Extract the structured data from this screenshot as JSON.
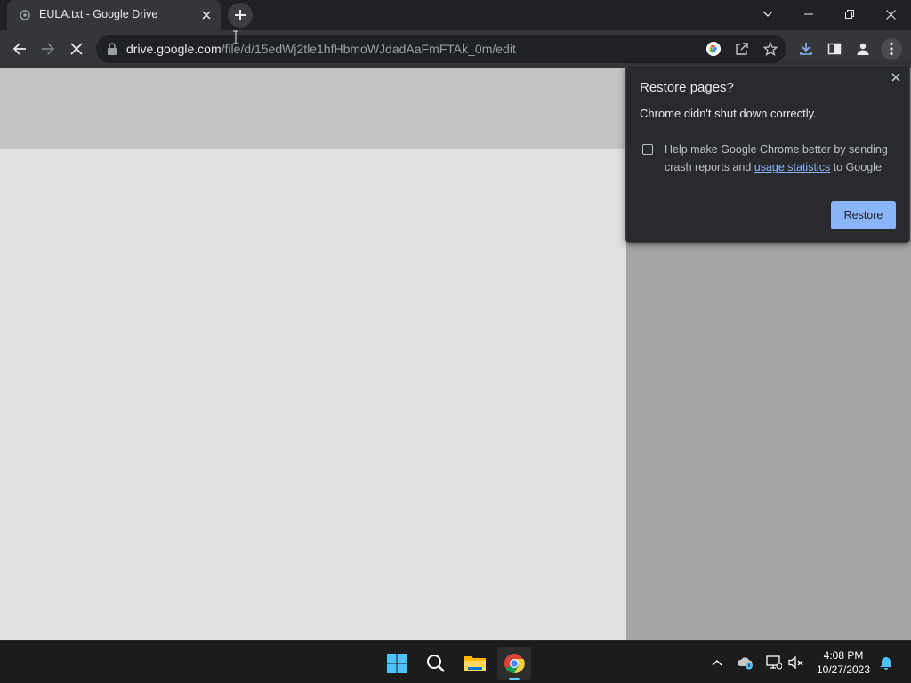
{
  "tab": {
    "title": "EULA.txt - Google Drive"
  },
  "address_bar": {
    "host": "drive.google.com",
    "path": "/file/d/15edWj2tle1hfHbmoWJdadAaFmFTAk_0m/edit"
  },
  "popup": {
    "title": "Restore pages?",
    "message": "Chrome didn't shut down correctly.",
    "crash_text_before": "Help make Google Chrome better by sending crash reports and ",
    "crash_link": "usage statistics",
    "crash_text_after": " to Google",
    "crash_checked": false,
    "restore_label": "Restore"
  },
  "taskbar": {
    "time": "4:08 PM",
    "date": "10/27/2023"
  },
  "colors": {
    "accent": "#8ab4f8",
    "frame": "#202124",
    "toolbar": "#35363a"
  },
  "icons": [
    "globe-icon",
    "close-icon",
    "plus-icon",
    "chevron-down-icon",
    "minimize-icon",
    "restore-icon",
    "back-icon",
    "forward-icon",
    "stop-icon",
    "lock-icon",
    "google-icon",
    "share-icon",
    "star-icon",
    "download-icon",
    "side-panel-icon",
    "profile-icon",
    "menu-icon",
    "windows-start-icon",
    "search-icon",
    "folder-icon",
    "chrome-icon",
    "chevron-up-icon",
    "onedrive-icon",
    "network-icon",
    "volume-icon",
    "bell-icon"
  ]
}
